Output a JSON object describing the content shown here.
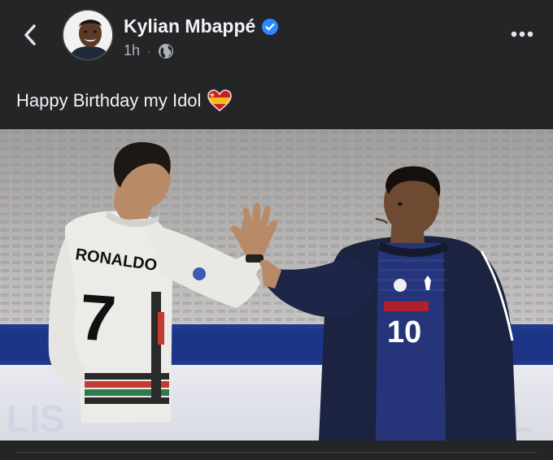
{
  "post": {
    "author": "Kylian Mbappé",
    "verified": true,
    "time": "1h",
    "audience_icon": "globe-icon",
    "caption": "Happy Birthday my Idol",
    "caption_emoji": "heart-flag-emoji"
  },
  "navigation": {
    "back_icon": "chevron-left-icon",
    "more_icon": "more-horizontal-icon"
  },
  "photo": {
    "jersey_left_name": "RONALDO",
    "jersey_left_number": "7",
    "jersey_right_number": "10"
  },
  "colors": {
    "background": "#242526",
    "text_primary": "#f0f2f5",
    "text_secondary": "#b0b3b8",
    "verified_blue": "#2d88ff"
  }
}
